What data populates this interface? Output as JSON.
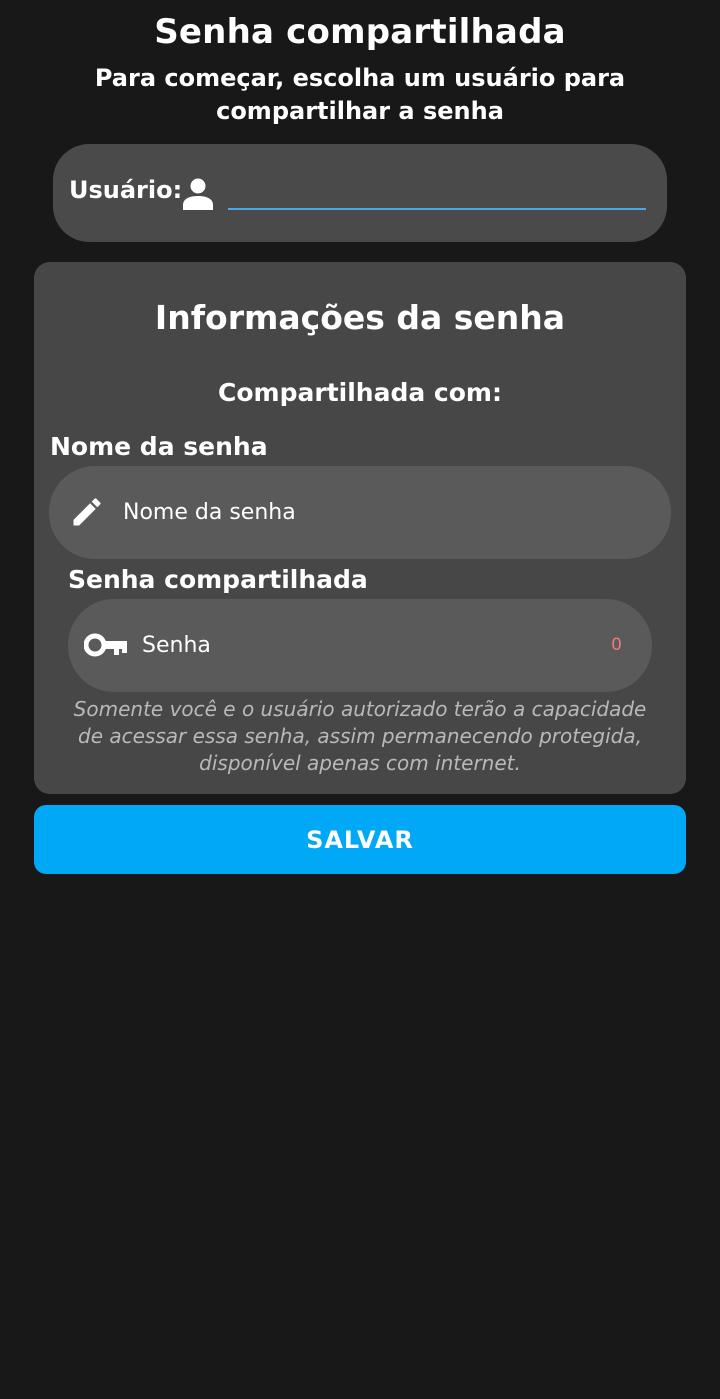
{
  "header": {
    "title": "Senha compartilhada",
    "subtitle": "Para começar, escolha um usuário para compartilhar a senha"
  },
  "user_section": {
    "label": "Usuário:",
    "icon": "person-icon",
    "value": "",
    "accent_color": "#4aa8e8"
  },
  "info_card": {
    "title": "Informações da senha",
    "shared_with_label": "Compartilhada com:",
    "name_label": "Nome da senha",
    "name_placeholder": "Nome da senha",
    "name_icon": "pencil-icon",
    "shared_password_label": "Senha compartilhada",
    "password_placeholder": "Senha",
    "password_icon": "key-icon",
    "password_counter": "0",
    "note": "Somente você e o usuário autorizado terão a capacidade de acessar essa senha, assim permanecendo protegida, disponível apenas com internet."
  },
  "actions": {
    "save_label": "SALVAR",
    "save_color": "#00a8f5"
  }
}
